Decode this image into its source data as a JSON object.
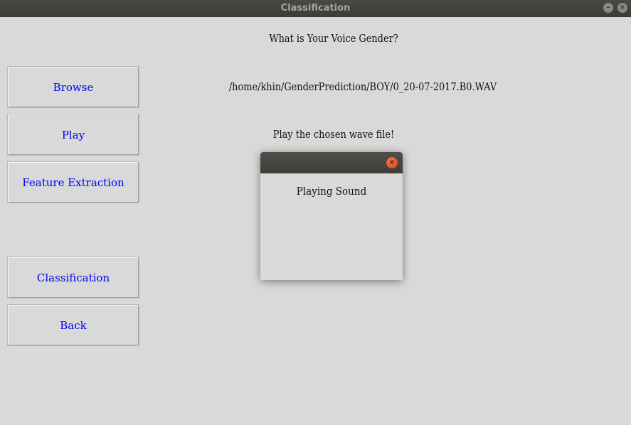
{
  "window": {
    "title": "Classification",
    "minimize_glyph": "–",
    "close_glyph": "×"
  },
  "sidebar": {
    "buttons": [
      {
        "id": "browse",
        "label": "Browse"
      },
      {
        "id": "play",
        "label": "Play"
      },
      {
        "id": "feature",
        "label": "Feature Extraction"
      },
      {
        "id": "classify",
        "label": "Classification"
      },
      {
        "id": "back",
        "label": "Back"
      }
    ]
  },
  "main": {
    "question": "What is Your Voice Gender?",
    "file_path": "/home/khin/GenderPrediction/BOY/0_20-07-2017.B0.WAV",
    "play_hint": "Play the chosen wave file!"
  },
  "dialog": {
    "message": "Playing Sound",
    "close_glyph": "×"
  },
  "colors": {
    "background": "#d9d9d9",
    "titlebar": "#3c3b37",
    "button_text": "#0000ee",
    "dialog_close": "#e95420"
  }
}
